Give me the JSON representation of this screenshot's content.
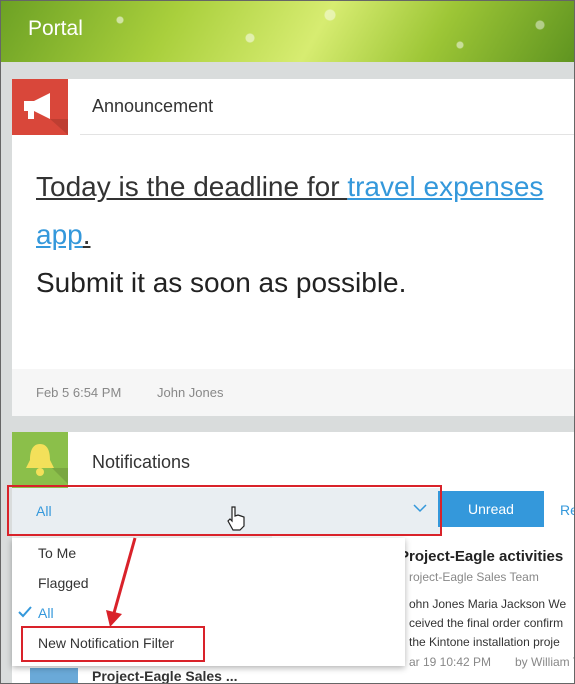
{
  "header": {
    "title": "Portal"
  },
  "announcement": {
    "title": "Announcement",
    "line1_part1": "Today is the deadline for ",
    "line1_link": "travel expenses app",
    "line1_end": ".",
    "line2": "Submit it as soon as possible.",
    "date": "Feb 5 6:54 PM",
    "author": "John Jones"
  },
  "notifications": {
    "title": "Notifications",
    "filter_current": "All",
    "tabs": {
      "unread": "Unread",
      "read_partial": "Re"
    },
    "dropdown": {
      "options": [
        "To Me",
        "Flagged",
        "All"
      ],
      "selected_index": 2,
      "new_filter": "New Notification Filter"
    },
    "detail": {
      "title": "Project-Eagle activities",
      "team": "roject-Eagle Sales Team",
      "line1": "ohn Jones Maria Jackson We",
      "line2": "ceived the final order confirm",
      "line3": "the Kintone installation proje",
      "meta": "ar 19 10:42 PM",
      "meta_by": "by William Ta"
    },
    "list_item_label": "Project-Eagle Sales ...",
    "icon_colors": {
      "announcement": "#d9473a",
      "notifications": "#8bbf4a",
      "accent": "#3498db"
    }
  }
}
